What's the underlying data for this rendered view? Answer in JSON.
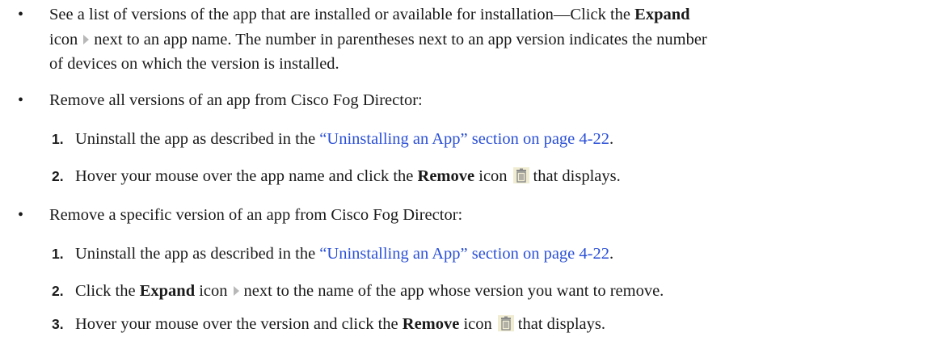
{
  "bullets": {
    "b1": {
      "line1_text": "See a list of versions of the app that are installed or available for installation—Click the ",
      "line1_bold": "Expand",
      "line2_word": "icon",
      "line2_rest": "next to an app name. The number in parentheses next to an app version indicates the number",
      "line3": "of devices on which the version is installed.",
      "icon": "expand-triangle-icon"
    },
    "b2": {
      "text": "Remove all versions of an app from Cisco Fog Director:",
      "step1": {
        "num": "1.",
        "before": "Uninstall the app as described in the ",
        "link": "“Uninstalling an App” section on page 4-22",
        "after": "."
      },
      "step2": {
        "num": "2.",
        "before": "Hover your mouse over the app name and click the ",
        "bold": "Remove",
        "mid": " icon",
        "after": "that displays.",
        "icon": "trash-icon"
      }
    },
    "b3": {
      "text": "Remove a specific version of an app from Cisco Fog Director:",
      "step1": {
        "num": "1.",
        "before": "Uninstall the app as described in the ",
        "link": "“Uninstalling an App” section on page 4-22",
        "after": "."
      },
      "step2": {
        "num": "2.",
        "before": "Click the ",
        "bold": "Expand",
        "mid": " icon",
        "after": "next to the name of the app whose version you want to remove.",
        "icon": "expand-triangle-icon"
      },
      "step3": {
        "num": "3.",
        "before": "Hover your mouse over the version and click the ",
        "bold": "Remove",
        "mid": " icon",
        "after": "that displays.",
        "icon": "trash-icon"
      }
    }
  },
  "colors": {
    "text": "#1a1a1a",
    "link": "#2a4fd6",
    "icon_gray": "#b8b8b8",
    "trash_fill": "#f0ecd2"
  }
}
